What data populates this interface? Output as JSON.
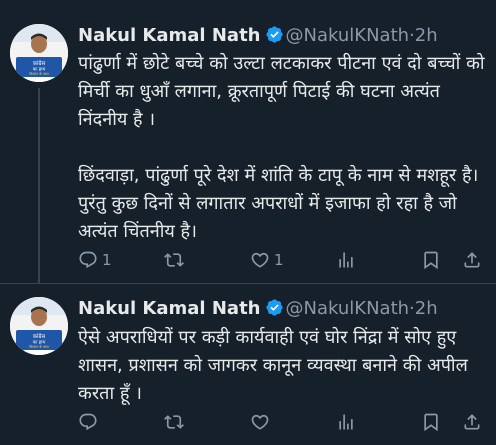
{
  "tweets": [
    {
      "name": "Nakul Kamal Nath",
      "handle": "@NakulKNath",
      "separator": "·",
      "time": "2h",
      "text": "पांढुर्णा में छोटे बच्चे को उल्टा लटकाकर पीटना एवं दो बच्चों को मिर्ची का धुआँ लगाना, क्रूरतापूर्ण पिटाई की घटना अत्यंत निंदनीय है ।\n\nछिंदवाड़ा, पांढुर्णा पूरे देश में शांति के टापू के नाम से मशहूर है। पुरंतु कुछ दिनों से लगातार अपराधों में इजाफा हो रहा है जो अत्यंत चिंतनीय है।",
      "reply_count": "1",
      "retweet_count": "",
      "like_count": "1",
      "view_count": ""
    },
    {
      "name": "Nakul Kamal Nath",
      "handle": "@NakulKNath",
      "separator": "·",
      "time": "2h",
      "text": "ऐसे अपराधियों पर कड़ी कार्यवाही एवं घोर निंद्रा में सोए हुए शासन, प्रशासन को जागकर कानून व्यवस्था बनाने की अपील करता हूँ ।",
      "reply_count": "",
      "retweet_count": "",
      "like_count": "",
      "view_count": ""
    }
  ],
  "avatar": {
    "badge_line1": "कांग्रेस",
    "badge_line2": "का हाथ",
    "badge_line3": "किसान के साथ"
  },
  "colors": {
    "background": "#15202b",
    "text_primary": "#e7e9ea",
    "text_secondary": "#8b98a5",
    "verified_badge": "#1d9bf0",
    "divider": "#38444d"
  },
  "icons": [
    "verified-badge-icon",
    "reply-icon",
    "retweet-icon",
    "like-icon",
    "views-icon",
    "bookmark-icon",
    "share-icon"
  ]
}
